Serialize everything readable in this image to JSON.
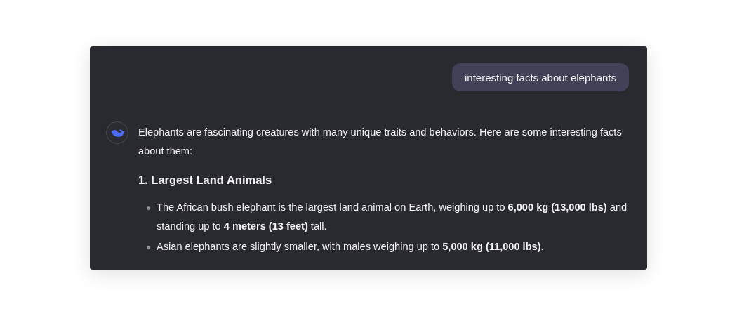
{
  "user_message": "interesting facts about elephants",
  "assistant": {
    "intro": "Elephants are fascinating creatures with many unique traits and behaviors. Here are some interesting facts about them:",
    "heading": "1. Largest Land Animals",
    "bullets": [
      "The African bush elephant is the largest land animal on Earth, weighing up to **6,000 kg (13,000 lbs)** and standing up to **4 meters (13 feet)** tall.",
      "Asian elephants are slightly smaller, with males weighing up to **5,000 kg (11,000 lbs)**."
    ]
  }
}
